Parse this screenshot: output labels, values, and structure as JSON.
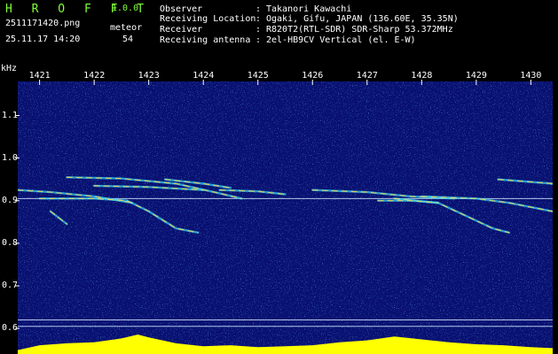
{
  "header": {
    "app_name": "H R O F F T",
    "version": "1.0.0",
    "file_name": "2511171420.png",
    "meteor_label": "meteor",
    "timestamp": "25.11.17 14:20",
    "meteor_count": "54"
  },
  "station": {
    "observer_label": "Observer",
    "observer_value": "Takanori Kawachi",
    "location_label": "Receiving Location",
    "location_value": "Ogaki, Gifu, JAPAN (136.60E, 35.35N)",
    "receiver_label": "Receiver",
    "receiver_value": "R820T2(RTL-SDR) SDR-Sharp 53.372MHz",
    "antenna_label": "Receiving antenna",
    "antenna_value": "2el-HB9CV Vertical (el. E-W)",
    "separator": ":"
  },
  "colors": {
    "title_green": "#7fff3a",
    "background_blue": "#081070",
    "profile_yellow": "#ffff00",
    "profile_cyan": "#00e0ff"
  },
  "chart_data": {
    "type": "heatmap",
    "xlabel": "",
    "ylabel": "kHz",
    "x_ticks": [
      "1421",
      "1422",
      "1423",
      "1424",
      "1425",
      "1426",
      "1427",
      "1428",
      "1429",
      "1430"
    ],
    "y_ticks": [
      "1.1",
      "1.0",
      "0.9",
      "0.8",
      "0.7",
      "0.6"
    ],
    "xlim": [
      1420.6,
      1430.4
    ],
    "ylim": [
      0.54,
      1.18
    ],
    "reference_lines_khz": [
      0.905,
      0.62,
      0.605
    ],
    "traces": [
      {
        "points": [
          [
            1420.6,
            0.925
          ],
          [
            1421.2,
            0.92
          ],
          [
            1422.0,
            0.91
          ],
          [
            1422.7,
            0.895
          ]
        ]
      },
      {
        "points": [
          [
            1421.0,
            0.905
          ],
          [
            1422.0,
            0.905
          ],
          [
            1422.6,
            0.9
          ],
          [
            1423.0,
            0.875
          ],
          [
            1423.5,
            0.835
          ],
          [
            1423.9,
            0.825
          ]
        ]
      },
      {
        "points": [
          [
            1421.2,
            0.875
          ],
          [
            1421.5,
            0.845
          ]
        ]
      },
      {
        "points": [
          [
            1421.5,
            0.955
          ],
          [
            1422.5,
            0.952
          ],
          [
            1423.5,
            0.94
          ],
          [
            1424.2,
            0.92
          ],
          [
            1424.7,
            0.905
          ]
        ]
      },
      {
        "points": [
          [
            1422.0,
            0.935
          ],
          [
            1423.0,
            0.932
          ],
          [
            1424.0,
            0.925
          ]
        ]
      },
      {
        "points": [
          [
            1423.3,
            0.95
          ],
          [
            1424.0,
            0.94
          ],
          [
            1424.5,
            0.93
          ]
        ]
      },
      {
        "points": [
          [
            1424.3,
            0.925
          ],
          [
            1425.0,
            0.922
          ],
          [
            1425.5,
            0.915
          ]
        ]
      },
      {
        "points": [
          [
            1426.0,
            0.925
          ],
          [
            1427.0,
            0.92
          ],
          [
            1427.8,
            0.91
          ],
          [
            1428.6,
            0.905
          ]
        ]
      },
      {
        "points": [
          [
            1427.5,
            0.905
          ],
          [
            1428.3,
            0.895
          ],
          [
            1428.8,
            0.865
          ],
          [
            1429.3,
            0.835
          ],
          [
            1429.6,
            0.825
          ]
        ]
      },
      {
        "points": [
          [
            1428.0,
            0.91
          ],
          [
            1429.0,
            0.905
          ],
          [
            1429.6,
            0.895
          ],
          [
            1430.4,
            0.875
          ]
        ]
      },
      {
        "points": [
          [
            1429.4,
            0.95
          ],
          [
            1430.4,
            0.94
          ]
        ]
      },
      {
        "points": [
          [
            1427.2,
            0.9
          ],
          [
            1427.8,
            0.9
          ],
          [
            1428.3,
            0.895
          ]
        ]
      }
    ],
    "profile": [
      {
        "x": 1420.6,
        "y": 0.2
      },
      {
        "x": 1421.0,
        "y": 0.45
      },
      {
        "x": 1421.5,
        "y": 0.55
      },
      {
        "x": 1422.0,
        "y": 0.6
      },
      {
        "x": 1422.5,
        "y": 0.8
      },
      {
        "x": 1422.8,
        "y": 1.0
      },
      {
        "x": 1423.0,
        "y": 0.85
      },
      {
        "x": 1423.5,
        "y": 0.55
      },
      {
        "x": 1424.0,
        "y": 0.4
      },
      {
        "x": 1424.5,
        "y": 0.45
      },
      {
        "x": 1425.0,
        "y": 0.35
      },
      {
        "x": 1425.5,
        "y": 0.4
      },
      {
        "x": 1426.0,
        "y": 0.45
      },
      {
        "x": 1426.5,
        "y": 0.6
      },
      {
        "x": 1427.0,
        "y": 0.7
      },
      {
        "x": 1427.5,
        "y": 0.9
      },
      {
        "x": 1428.0,
        "y": 0.75
      },
      {
        "x": 1428.5,
        "y": 0.6
      },
      {
        "x": 1429.0,
        "y": 0.5
      },
      {
        "x": 1429.5,
        "y": 0.45
      },
      {
        "x": 1430.0,
        "y": 0.35
      },
      {
        "x": 1430.4,
        "y": 0.3
      }
    ]
  }
}
